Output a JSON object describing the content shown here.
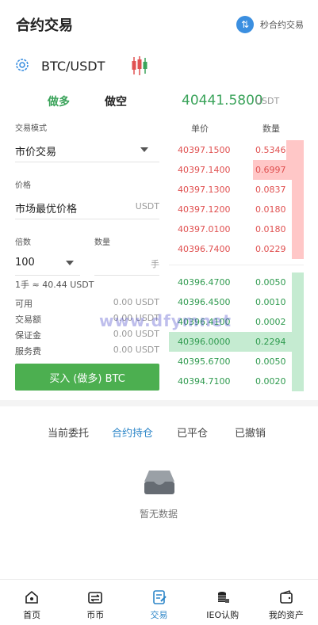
{
  "header": {
    "title": "合约交易",
    "miao_label": "秒合约交易",
    "miao_icon": "swap-arrows-icon"
  },
  "pair": {
    "symbol": "BTC/USDT"
  },
  "trade_tabs": {
    "long": "做多",
    "short": "做空"
  },
  "last_price": {
    "value": "40441.5800",
    "unit": "USDT"
  },
  "form": {
    "mode_label": "交易模式",
    "mode_value": "市价交易",
    "price_label": "价格",
    "price_value": "市场最优价格",
    "price_unit": "USDT",
    "leverage_label": "倍数",
    "leverage_value": "100",
    "qty_label": "数量",
    "qty_unit": "手",
    "lot_note": "1手 ≈ 40.44 USDT",
    "info": [
      {
        "label": "可用",
        "value": "0.00 USDT"
      },
      {
        "label": "交易额",
        "value": "0.00 USDT"
      },
      {
        "label": "保证金",
        "value": "0.00 USDT"
      },
      {
        "label": "服务费",
        "value": "0.00 USDT"
      }
    ],
    "buy_button": "买入 (做多) BTC"
  },
  "orderbook": {
    "price_header": "单价",
    "qty_header": "数量",
    "asks": [
      {
        "price": "40397.1500",
        "qty": "0.5346",
        "depth": 0.12
      },
      {
        "price": "40397.1400",
        "qty": "0.6997",
        "depth": 0.27
      },
      {
        "price": "40397.1300",
        "qty": "0.0837",
        "depth": 0.1
      },
      {
        "price": "40397.1200",
        "qty": "0.0180",
        "depth": 0.1
      },
      {
        "price": "40397.0100",
        "qty": "0.0180",
        "depth": 0.1
      },
      {
        "price": "40396.7400",
        "qty": "0.0229",
        "depth": 0.1
      }
    ],
    "bids": [
      {
        "price": "40396.4700",
        "qty": "0.0050",
        "depth": 0.1
      },
      {
        "price": "40396.4500",
        "qty": "0.0010",
        "depth": 0.1
      },
      {
        "price": "40396.4100",
        "qty": "0.0002",
        "depth": 0.1
      },
      {
        "price": "40396.0000",
        "qty": "0.2294",
        "depth": 1.0
      },
      {
        "price": "40395.6700",
        "qty": "0.0050",
        "depth": 0.1
      },
      {
        "price": "40394.7100",
        "qty": "0.0020",
        "depth": 0.1
      }
    ],
    "ask_color": "#e05050",
    "bid_color": "#2e9a4e",
    "ask_bar": "#ffc7c7",
    "bid_bar": "#c5ebd1"
  },
  "orders_tabs": [
    "当前委托",
    "合约持仓",
    "已平仓",
    "已撤销"
  ],
  "orders_active": "合约持仓",
  "empty_text": "暂无数据",
  "watermark": "www.dfymnet",
  "nav": [
    {
      "label": "首页",
      "icon": "home-icon"
    },
    {
      "label": "币币",
      "icon": "exchange-icon"
    },
    {
      "label": "交易",
      "icon": "trade-icon"
    },
    {
      "label": "IEO认购",
      "icon": "coins-icon"
    },
    {
      "label": "我的资产",
      "icon": "wallet-icon"
    }
  ]
}
